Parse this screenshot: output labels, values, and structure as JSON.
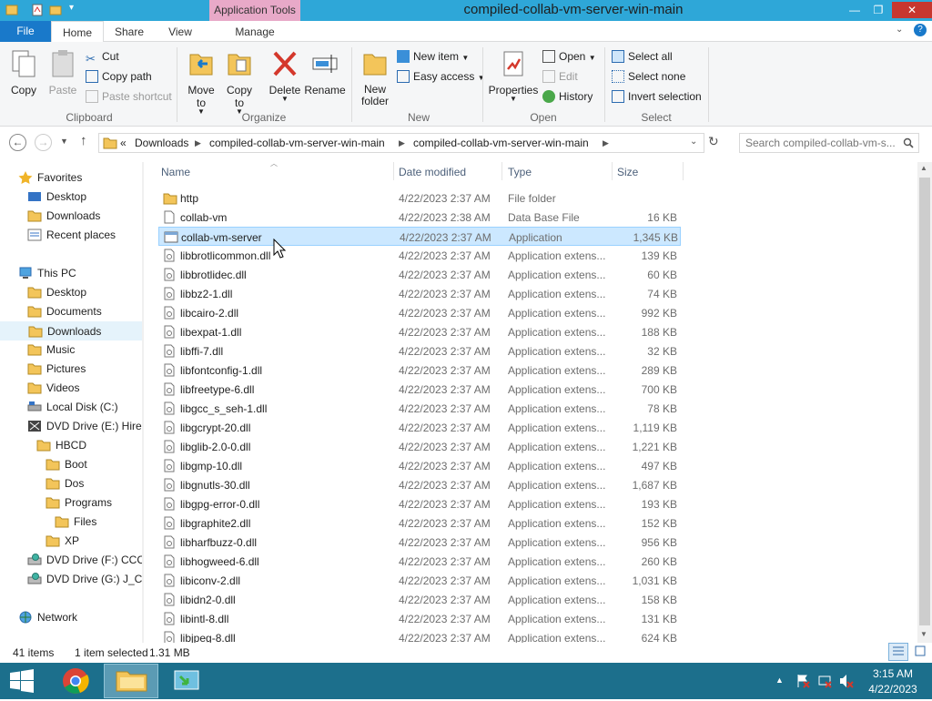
{
  "window": {
    "title": "compiled-collab-vm-server-win-main",
    "app_tools_tab": "Application Tools"
  },
  "ribbon_tabs": {
    "file": "File",
    "home": "Home",
    "share": "Share",
    "view": "View",
    "manage": "Manage"
  },
  "ribbon": {
    "clipboard": {
      "copy": "Copy",
      "paste": "Paste",
      "cut": "Cut",
      "copy_path": "Copy path",
      "paste_shortcut": "Paste shortcut",
      "label": "Clipboard"
    },
    "organize": {
      "move_to": "Move to",
      "copy_to": "Copy to",
      "delete": "Delete",
      "rename": "Rename",
      "label": "Organize"
    },
    "new": {
      "new_folder": "New folder",
      "new_item": "New item",
      "easy_access": "Easy access",
      "label": "New"
    },
    "open": {
      "properties": "Properties",
      "open": "Open",
      "edit": "Edit",
      "history": "History",
      "label": "Open"
    },
    "select": {
      "select_all": "Select all",
      "select_none": "Select none",
      "invert_selection": "Invert selection",
      "label": "Select"
    }
  },
  "address": {
    "overflow": "«",
    "crumbs": [
      "Downloads",
      "compiled-collab-vm-server-win-main",
      "compiled-collab-vm-server-win-main"
    ],
    "search_placeholder": "Search compiled-collab-vm-s..."
  },
  "nav": {
    "favorites": "Favorites",
    "desktop": "Desktop",
    "downloads": "Downloads",
    "recent": "Recent places",
    "this_pc": "This PC",
    "pc_desktop": "Desktop",
    "documents": "Documents",
    "pc_downloads": "Downloads",
    "music": "Music",
    "pictures": "Pictures",
    "videos": "Videos",
    "local_disk": "Local Disk (C:)",
    "dvd_e": "DVD Drive (E:) Hiren",
    "hbcd": "HBCD",
    "boot": "Boot",
    "dos": "Dos",
    "programs": "Programs",
    "files": "Files",
    "xp": "XP",
    "dvd_f": "DVD Drive (F:) CCCC",
    "dvd_g": "DVD Drive (G:) J_CEN",
    "network": "Network"
  },
  "columns": {
    "name": "Name",
    "date": "Date modified",
    "type": "Type",
    "size": "Size"
  },
  "files": [
    {
      "name": "http",
      "date": "4/22/2023 2:37 AM",
      "type": "File folder",
      "size": ""
    },
    {
      "name": "collab-vm",
      "date": "4/22/2023 2:38 AM",
      "type": "Data Base File",
      "size": "16 KB"
    },
    {
      "name": "collab-vm-server",
      "date": "4/22/2023 2:37 AM",
      "type": "Application",
      "size": "1,345 KB"
    },
    {
      "name": "libbrotlicommon.dll",
      "date": "4/22/2023 2:37 AM",
      "type": "Application extens...",
      "size": "139 KB"
    },
    {
      "name": "libbrotlidec.dll",
      "date": "4/22/2023 2:37 AM",
      "type": "Application extens...",
      "size": "60 KB"
    },
    {
      "name": "libbz2-1.dll",
      "date": "4/22/2023 2:37 AM",
      "type": "Application extens...",
      "size": "74 KB"
    },
    {
      "name": "libcairo-2.dll",
      "date": "4/22/2023 2:37 AM",
      "type": "Application extens...",
      "size": "992 KB"
    },
    {
      "name": "libexpat-1.dll",
      "date": "4/22/2023 2:37 AM",
      "type": "Application extens...",
      "size": "188 KB"
    },
    {
      "name": "libffi-7.dll",
      "date": "4/22/2023 2:37 AM",
      "type": "Application extens...",
      "size": "32 KB"
    },
    {
      "name": "libfontconfig-1.dll",
      "date": "4/22/2023 2:37 AM",
      "type": "Application extens...",
      "size": "289 KB"
    },
    {
      "name": "libfreetype-6.dll",
      "date": "4/22/2023 2:37 AM",
      "type": "Application extens...",
      "size": "700 KB"
    },
    {
      "name": "libgcc_s_seh-1.dll",
      "date": "4/22/2023 2:37 AM",
      "type": "Application extens...",
      "size": "78 KB"
    },
    {
      "name": "libgcrypt-20.dll",
      "date": "4/22/2023 2:37 AM",
      "type": "Application extens...",
      "size": "1,119 KB"
    },
    {
      "name": "libglib-2.0-0.dll",
      "date": "4/22/2023 2:37 AM",
      "type": "Application extens...",
      "size": "1,221 KB"
    },
    {
      "name": "libgmp-10.dll",
      "date": "4/22/2023 2:37 AM",
      "type": "Application extens...",
      "size": "497 KB"
    },
    {
      "name": "libgnutls-30.dll",
      "date": "4/22/2023 2:37 AM",
      "type": "Application extens...",
      "size": "1,687 KB"
    },
    {
      "name": "libgpg-error-0.dll",
      "date": "4/22/2023 2:37 AM",
      "type": "Application extens...",
      "size": "193 KB"
    },
    {
      "name": "libgraphite2.dll",
      "date": "4/22/2023 2:37 AM",
      "type": "Application extens...",
      "size": "152 KB"
    },
    {
      "name": "libharfbuzz-0.dll",
      "date": "4/22/2023 2:37 AM",
      "type": "Application extens...",
      "size": "956 KB"
    },
    {
      "name": "libhogweed-6.dll",
      "date": "4/22/2023 2:37 AM",
      "type": "Application extens...",
      "size": "260 KB"
    },
    {
      "name": "libiconv-2.dll",
      "date": "4/22/2023 2:37 AM",
      "type": "Application extens...",
      "size": "1,031 KB"
    },
    {
      "name": "libidn2-0.dll",
      "date": "4/22/2023 2:37 AM",
      "type": "Application extens...",
      "size": "158 KB"
    },
    {
      "name": "libintl-8.dll",
      "date": "4/22/2023 2:37 AM",
      "type": "Application extens...",
      "size": "131 KB"
    },
    {
      "name": "libjpeg-8.dll",
      "date": "4/22/2023 2:37 AM",
      "type": "Application extens...",
      "size": "624 KB"
    }
  ],
  "selected_index": 2,
  "status": {
    "items": "41 items",
    "selected": "1 item selected",
    "size": "1.31 MB"
  },
  "taskbar": {
    "time": "3:15 AM",
    "date": "4/22/2023"
  },
  "colors": {
    "titlebar": "#2ea7d8",
    "file_tab": "#1979ca",
    "app_tools": "#e8a9c8",
    "selection": "#cce8ff",
    "taskbar": "#1c6f8c"
  }
}
